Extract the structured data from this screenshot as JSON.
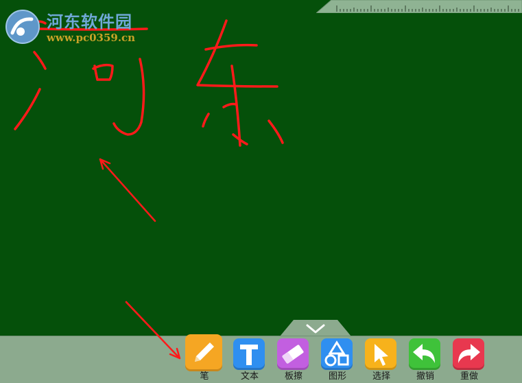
{
  "watermark": {
    "title": "河东软件园",
    "url": "www.pc0359.cn"
  },
  "toolbar": {
    "tools": [
      {
        "label": "笔",
        "color": "#f5a623",
        "icon": "pen-icon"
      },
      {
        "label": "文本",
        "color": "#2f8ff0",
        "icon": "text-t-icon"
      },
      {
        "label": "板擦",
        "color": "#c25fe0",
        "icon": "eraser-icon"
      },
      {
        "label": "图形",
        "color": "#2f8ff0",
        "icon": "shapes-icon"
      },
      {
        "label": "选择",
        "color": "#f7b21b",
        "icon": "cursor-icon"
      },
      {
        "label": "撤销",
        "color": "#3fc23a",
        "icon": "undo-icon"
      },
      {
        "label": "重做",
        "color": "#e8384f",
        "icon": "redo-icon"
      }
    ]
  },
  "colors": {
    "board": "#05500a",
    "ink": "#ff1a1a",
    "toolbar": "#8caa8e"
  }
}
